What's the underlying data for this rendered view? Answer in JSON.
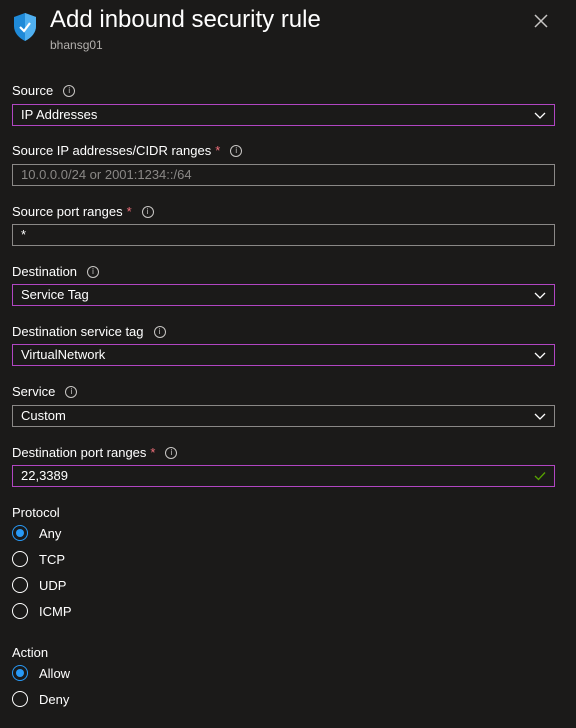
{
  "header": {
    "title": "Add inbound security rule",
    "subtitle": "bhansg01",
    "icon": "shield-icon"
  },
  "form": {
    "source": {
      "label": "Source",
      "value": "IP Addresses"
    },
    "source_ip": {
      "label": "Source IP addresses/CIDR ranges",
      "required": "*",
      "placeholder": "10.0.0.0/24 or 2001:1234::/64"
    },
    "source_port": {
      "label": "Source port ranges",
      "required": "*",
      "value": "*"
    },
    "destination": {
      "label": "Destination",
      "value": "Service Tag"
    },
    "dest_service_tag": {
      "label": "Destination service tag",
      "value": "VirtualNetwork"
    },
    "service": {
      "label": "Service",
      "value": "Custom"
    },
    "dest_port": {
      "label": "Destination port ranges",
      "required": "*",
      "value": "22,3389"
    },
    "protocol": {
      "label": "Protocol",
      "options": [
        "Any",
        "TCP",
        "UDP",
        "ICMP"
      ],
      "selected": "Any"
    },
    "action": {
      "label": "Action",
      "options": [
        "Allow",
        "Deny"
      ],
      "selected": "Allow"
    }
  },
  "colors": {
    "background": "#1b1a19",
    "focus_border": "#b146c2",
    "radio_selected": "#2899f5",
    "required": "#f1707b",
    "valid_check": "#57a300"
  }
}
